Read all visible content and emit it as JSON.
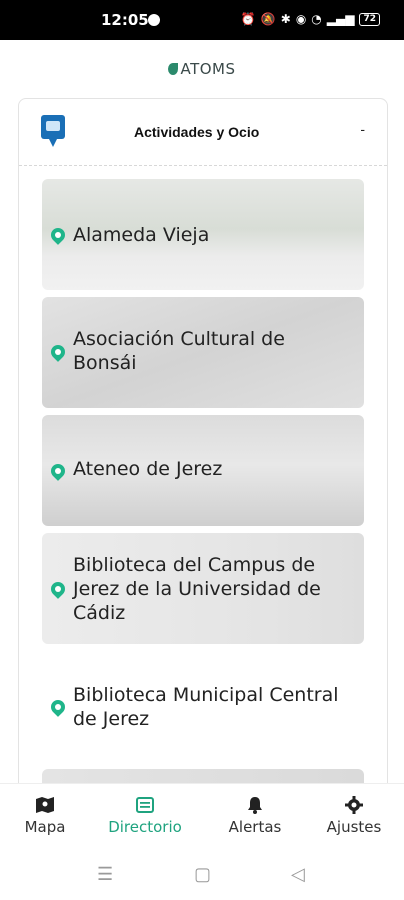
{
  "status": {
    "time": "12:05",
    "battery": "72"
  },
  "brand": {
    "name": "ATOMS"
  },
  "category": {
    "title": "Actividades y Ocio",
    "collapse_symbol": "-"
  },
  "items": [
    {
      "label": "Alameda Vieja"
    },
    {
      "label": "Asociación Cultural de Bonsái"
    },
    {
      "label": "Ateneo de Jerez"
    },
    {
      "label": "Biblioteca del Campus de Jerez de la Universidad de Cádiz"
    },
    {
      "label": "Biblioteca Municipal Central de Jerez"
    }
  ],
  "nav": {
    "mapa": "Mapa",
    "directorio": "Directorio",
    "alertas": "Alertas",
    "ajustes": "Ajustes"
  },
  "colors": {
    "accent": "#1fa37f",
    "category_icon": "#1a6fb6",
    "pin": "#1fb58a"
  }
}
